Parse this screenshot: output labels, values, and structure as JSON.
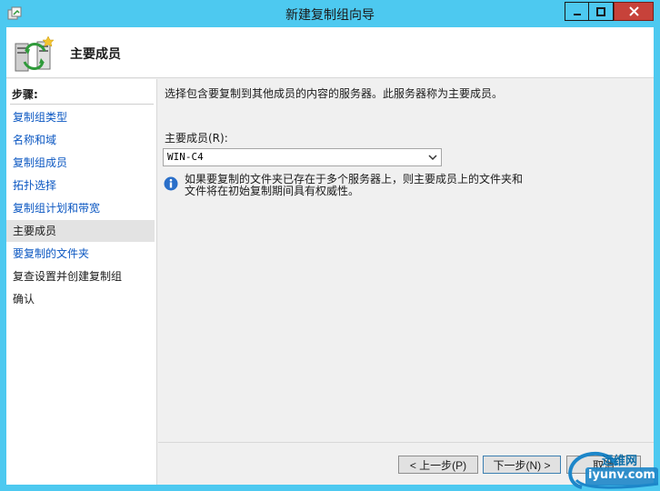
{
  "window": {
    "title": "新建复制组向导",
    "colors": {
      "titlebar": "#4dc9f0",
      "close": "#c7423a",
      "link": "#0b57c2"
    }
  },
  "header": {
    "title": "主要成员",
    "icon": "replication-group-wizard-icon"
  },
  "sidebar": {
    "title": "步骤:",
    "items": [
      {
        "label": "复制组类型",
        "state": "link"
      },
      {
        "label": "名称和域",
        "state": "link"
      },
      {
        "label": "复制组成员",
        "state": "link"
      },
      {
        "label": "拓扑选择",
        "state": "link"
      },
      {
        "label": "复制组计划和带宽",
        "state": "link"
      },
      {
        "label": "主要成员",
        "state": "current"
      },
      {
        "label": "要复制的文件夹",
        "state": "link"
      },
      {
        "label": "复查设置并创建复制组",
        "state": "plain"
      },
      {
        "label": "确认",
        "state": "plain"
      }
    ]
  },
  "content": {
    "description": "选择包含要复制到其他成员的内容的服务器。此服务器称为主要成员。",
    "field_label": "主要成员(R):",
    "selected_member": "WIN-C4",
    "info_line1": "如果要复制的文件夹已存在于多个服务器上，则主要成员上的文件夹和",
    "info_line2": "文件将在初始复制期间具有权威性。"
  },
  "buttons": {
    "prev": "< 上一步(P)",
    "next": "下一步(N) >",
    "cancel": "取消"
  },
  "watermark": {
    "cn": "运维网",
    "url": "iyunv.com"
  }
}
